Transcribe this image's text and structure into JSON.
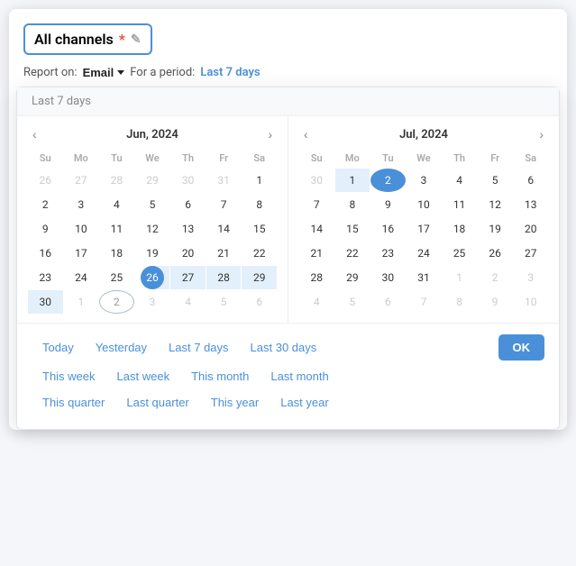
{
  "header": {
    "channel_name": "All channels",
    "asterisk": "*",
    "edit_icon": "✎",
    "report_label": "Report on:",
    "report_value": "Email",
    "period_label": "For a period:",
    "period_value": "Last 7 days"
  },
  "dropdown": {
    "quick_label": "Last 7 days"
  },
  "calendar_left": {
    "title": "Jun, 2024",
    "prev_nav": "‹",
    "next_nav": "›",
    "day_headers": [
      "Su",
      "Mo",
      "Tu",
      "We",
      "Th",
      "Fr",
      "Sa"
    ],
    "weeks": [
      [
        {
          "n": "26",
          "cls": "other-month"
        },
        {
          "n": "27",
          "cls": "other-month"
        },
        {
          "n": "28",
          "cls": "other-month"
        },
        {
          "n": "29",
          "cls": "other-month"
        },
        {
          "n": "30",
          "cls": "other-month"
        },
        {
          "n": "31",
          "cls": "other-month"
        },
        {
          "n": "1",
          "cls": ""
        }
      ],
      [
        {
          "n": "2",
          "cls": ""
        },
        {
          "n": "3",
          "cls": ""
        },
        {
          "n": "4",
          "cls": ""
        },
        {
          "n": "5",
          "cls": ""
        },
        {
          "n": "6",
          "cls": ""
        },
        {
          "n": "7",
          "cls": ""
        },
        {
          "n": "8",
          "cls": ""
        }
      ],
      [
        {
          "n": "9",
          "cls": ""
        },
        {
          "n": "10",
          "cls": ""
        },
        {
          "n": "11",
          "cls": ""
        },
        {
          "n": "12",
          "cls": ""
        },
        {
          "n": "13",
          "cls": ""
        },
        {
          "n": "14",
          "cls": ""
        },
        {
          "n": "15",
          "cls": ""
        }
      ],
      [
        {
          "n": "16",
          "cls": ""
        },
        {
          "n": "17",
          "cls": ""
        },
        {
          "n": "18",
          "cls": ""
        },
        {
          "n": "19",
          "cls": ""
        },
        {
          "n": "20",
          "cls": ""
        },
        {
          "n": "21",
          "cls": ""
        },
        {
          "n": "22",
          "cls": ""
        }
      ],
      [
        {
          "n": "23",
          "cls": ""
        },
        {
          "n": "24",
          "cls": ""
        },
        {
          "n": "25",
          "cls": ""
        },
        {
          "n": "26",
          "cls": "range-start-selected"
        },
        {
          "n": "27",
          "cls": "in-range"
        },
        {
          "n": "28",
          "cls": "in-range"
        },
        {
          "n": "29",
          "cls": "in-range"
        }
      ],
      [
        {
          "n": "30",
          "cls": "other-month in-range"
        },
        {
          "n": "1",
          "cls": "other-month"
        },
        {
          "n": "2",
          "cls": "other-month today-outline"
        },
        {
          "n": "3",
          "cls": "other-month"
        },
        {
          "n": "4",
          "cls": "other-month"
        },
        {
          "n": "5",
          "cls": "other-month"
        },
        {
          "n": "6",
          "cls": "other-month"
        }
      ]
    ]
  },
  "calendar_right": {
    "title": "Jul, 2024",
    "prev_nav": "‹",
    "next_nav": "›",
    "day_headers": [
      "Su",
      "Mo",
      "Tu",
      "We",
      "Th",
      "Fr",
      "Sa"
    ],
    "weeks": [
      [
        {
          "n": "30",
          "cls": "other-month"
        },
        {
          "n": "1",
          "cls": "range-end-pre"
        },
        {
          "n": "2",
          "cls": "selected"
        },
        {
          "n": "3",
          "cls": ""
        },
        {
          "n": "4",
          "cls": ""
        },
        {
          "n": "5",
          "cls": ""
        },
        {
          "n": "6",
          "cls": ""
        }
      ],
      [
        {
          "n": "7",
          "cls": ""
        },
        {
          "n": "8",
          "cls": ""
        },
        {
          "n": "9",
          "cls": ""
        },
        {
          "n": "10",
          "cls": ""
        },
        {
          "n": "11",
          "cls": ""
        },
        {
          "n": "12",
          "cls": ""
        },
        {
          "n": "13",
          "cls": ""
        }
      ],
      [
        {
          "n": "14",
          "cls": ""
        },
        {
          "n": "15",
          "cls": ""
        },
        {
          "n": "16",
          "cls": ""
        },
        {
          "n": "17",
          "cls": ""
        },
        {
          "n": "18",
          "cls": ""
        },
        {
          "n": "19",
          "cls": ""
        },
        {
          "n": "20",
          "cls": ""
        }
      ],
      [
        {
          "n": "21",
          "cls": ""
        },
        {
          "n": "22",
          "cls": ""
        },
        {
          "n": "23",
          "cls": ""
        },
        {
          "n": "24",
          "cls": ""
        },
        {
          "n": "25",
          "cls": ""
        },
        {
          "n": "26",
          "cls": ""
        },
        {
          "n": "27",
          "cls": ""
        }
      ],
      [
        {
          "n": "28",
          "cls": ""
        },
        {
          "n": "29",
          "cls": ""
        },
        {
          "n": "30",
          "cls": ""
        },
        {
          "n": "31",
          "cls": ""
        },
        {
          "n": "1",
          "cls": "other-month"
        },
        {
          "n": "2",
          "cls": "other-month"
        },
        {
          "n": "3",
          "cls": "other-month"
        }
      ],
      [
        {
          "n": "4",
          "cls": "other-month"
        },
        {
          "n": "5",
          "cls": "other-month"
        },
        {
          "n": "6",
          "cls": "other-month"
        },
        {
          "n": "7",
          "cls": "other-month"
        },
        {
          "n": "8",
          "cls": "other-month"
        },
        {
          "n": "9",
          "cls": "other-month"
        },
        {
          "n": "10",
          "cls": "other-month"
        }
      ]
    ]
  },
  "shortcuts": {
    "row1": [
      "Today",
      "Yesterday",
      "Last 7 days",
      "Last 30 days"
    ],
    "row2": [
      "This week",
      "Last week",
      "This month",
      "Last month"
    ],
    "row3": [
      "This quarter",
      "Last quarter",
      "This year",
      "Last year"
    ],
    "ok_label": "OK"
  }
}
